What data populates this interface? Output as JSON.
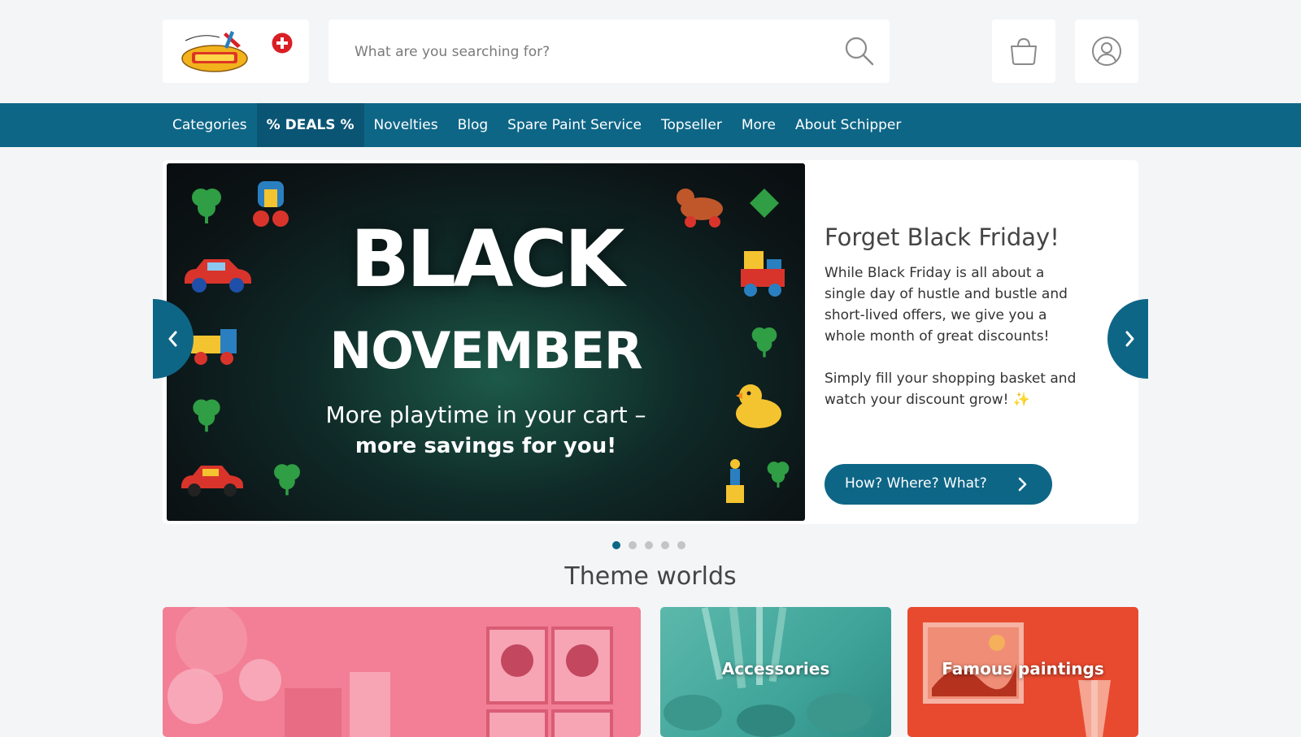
{
  "search": {
    "placeholder": "What are you searching for?"
  },
  "nav": {
    "items": [
      {
        "label": "Categories"
      },
      {
        "label": "% DEALS %"
      },
      {
        "label": "Novelties"
      },
      {
        "label": "Blog"
      },
      {
        "label": "Spare Paint Service"
      },
      {
        "label": "Topseller"
      },
      {
        "label": "More"
      },
      {
        "label": "About Schipper"
      }
    ]
  },
  "hero": {
    "banner": {
      "title_line1": "BLACK",
      "title_line2": "NOVEMBER",
      "sub_line1": "More playtime in your cart –",
      "sub_line2": "more savings for you!"
    },
    "title": "Forget Black Friday!",
    "paragraph1": "While Black Friday is all about a single day of hustle and bustle and short-lived offers, we give you a whole month of great discounts!",
    "paragraph2": "Simply fill your shopping basket and watch your discount grow! ✨",
    "button_label": "How? Where? What?",
    "slides_count": 5,
    "active_slide": 1
  },
  "theme_worlds": {
    "title": "Theme worlds",
    "tiles": [
      {
        "label": ""
      },
      {
        "label": "Accessories"
      },
      {
        "label": "Famous paintings"
      }
    ]
  },
  "colors": {
    "brand_blue": "#0e6687",
    "deals_bg": "#0b5574",
    "plus_red": "#d91f26",
    "tile_pink": "#f27f95",
    "tile_teal": "#4fae9f",
    "tile_red": "#e84a2f"
  },
  "icons": {
    "logo": "schipper-logo",
    "plus": "plus-circle-icon",
    "search": "search-icon",
    "basket": "basket-icon",
    "account": "user-icon",
    "prev": "chevron-left-icon",
    "next": "chevron-right-icon",
    "button_arrow": "chevron-right-icon"
  }
}
